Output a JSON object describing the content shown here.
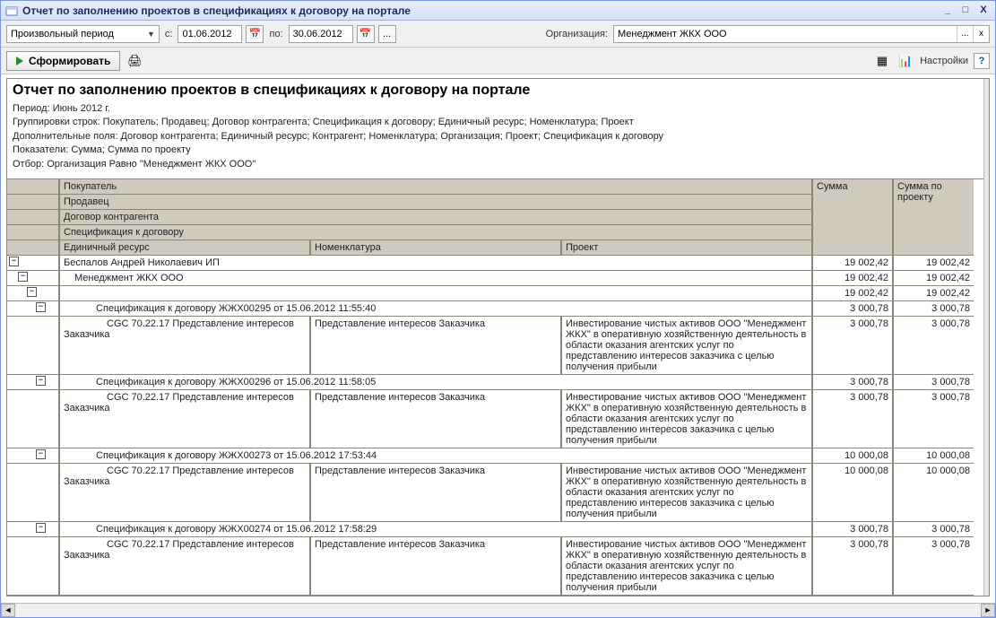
{
  "window": {
    "title": "Отчет по заполнению проектов в спецификациях к договору на портале",
    "min": "_",
    "max": "□",
    "close": "X"
  },
  "filter": {
    "period_select": "Произвольный период",
    "from_lbl": "с:",
    "from": "01.06.2012",
    "to_lbl": "по:",
    "to": "30.06.2012",
    "dots": "...",
    "org_lbl": "Организация:",
    "org": "Менеджмент ЖКХ ООО",
    "org_clear": "x"
  },
  "actions": {
    "form": "Сформировать",
    "settings": "Настройки",
    "help": "?"
  },
  "report": {
    "title": "Отчет по заполнению проектов в спецификациях к договору на портале",
    "period": "Период: Июнь 2012 г.",
    "groups": "Группировки строк: Покупатель; Продавец; Договор контрагента; Спецификация к договору; Единичный ресурс; Номенклатура; Проект",
    "extrafields": "Дополнительные поля: Договор контрагента; Единичный ресурс; Контрагент; Номенклатура; Организация; Проект; Спецификация к договору",
    "indicators": "Показатели: Сумма; Сумма по проекту",
    "selection": "Отбор: Организация Равно \"Менеджмент ЖКХ ООО\""
  },
  "headers": {
    "buyer": "Покупатель",
    "seller": "Продавец",
    "contract": "Договор контрагента",
    "spec": "Спецификация к договору",
    "resource": "Единичный ресурс",
    "nom": "Номенклатура",
    "project": "Проект",
    "sum": "Сумма",
    "sum_proj": "Сумма по проекту"
  },
  "rows": [
    {
      "lvl": 0,
      "text": "Беспалов Андрей Николаевич ИП",
      "sum": "19 002,42",
      "sum2": "19 002,42"
    },
    {
      "lvl": 1,
      "text": "Менеджмент ЖКХ ООО",
      "sum": "19 002,42",
      "sum2": "19 002,42"
    },
    {
      "lvl": 2,
      "text": "",
      "sum": "19 002,42",
      "sum2": "19 002,42"
    },
    {
      "lvl": 3,
      "text": "Спецификация к договору ЖЖХ00295 от 15.06.2012 11:55:40",
      "sum": "3 000,78",
      "sum2": "3 000,78"
    },
    {
      "lvl": 4,
      "res": "CGC 70.22.17 Представление интересов Заказчика",
      "nom": "Представление интересов Заказчика",
      "proj": "Инвестирование чистых активов ООО \"Менеджмент ЖКХ\" в оперативную хозяйственную деятельность в области оказания агентских услуг по представлению интересов заказчика с целью получения прибыли",
      "sum": "3 000,78",
      "sum2": "3 000,78"
    },
    {
      "lvl": 3,
      "text": "Спецификация к договору ЖЖХ00296 от 15.06.2012 11:58:05",
      "sum": "3 000,78",
      "sum2": "3 000,78"
    },
    {
      "lvl": 4,
      "res": "CGC 70.22.17 Представление интересов Заказчика",
      "nom": "Представление интересов Заказчика",
      "proj": "Инвестирование чистых активов ООО \"Менеджмент ЖКХ\" в оперативную хозяйственную деятельность в области оказания агентских услуг по представлению интересов заказчика с целью получения прибыли",
      "sum": "3 000,78",
      "sum2": "3 000,78"
    },
    {
      "lvl": 3,
      "text": "Спецификация к договору ЖЖХ00273 от 15.06.2012 17:53:44",
      "sum": "10 000,08",
      "sum2": "10 000,08"
    },
    {
      "lvl": 4,
      "res": "CGC 70.22.17 Представление интересов Заказчика",
      "nom": "Представление интересов Заказчика",
      "proj": "Инвестирование чистых активов ООО \"Менеджмент ЖКХ\" в оперативную хозяйственную деятельность в области оказания агентских услуг по представлению интересов заказчика с целью получения прибыли",
      "sum": "10 000,08",
      "sum2": "10 000,08"
    },
    {
      "lvl": 3,
      "text": "Спецификация к договору ЖЖХ00274 от 15.06.2012 17:58:29",
      "sum": "3 000,78",
      "sum2": "3 000,78"
    },
    {
      "lvl": 4,
      "res": "CGC 70.22.17 Представление интересов Заказчика",
      "nom": "Представление интересов Заказчика",
      "proj": "Инвестирование чистых активов ООО \"Менеджмент ЖКХ\" в оперативную хозяйственную деятельность в области оказания агентских услуг по представлению интересов заказчика с целью получения прибыли",
      "sum": "3 000,78",
      "sum2": "3 000,78"
    }
  ]
}
